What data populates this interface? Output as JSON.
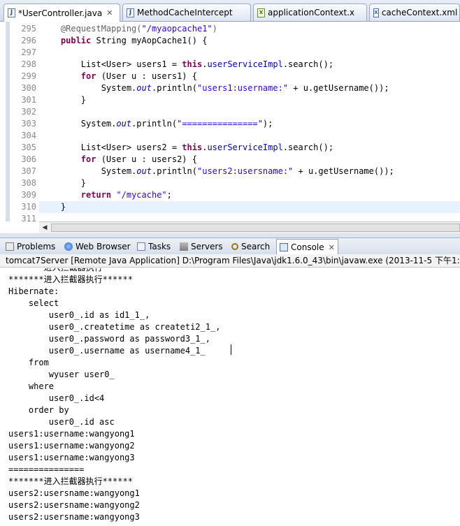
{
  "editor_tabs": [
    {
      "label": "*UserController.java",
      "icon": "java-file-icon",
      "close": "✕",
      "active": true
    },
    {
      "label": "MethodCacheIntercept",
      "icon": "java-file-icon"
    },
    {
      "label": "applicationContext.x",
      "icon": "xml-file-icon"
    },
    {
      "label": "cacheContext.xml",
      "icon": "xml-file-icon"
    }
  ],
  "editor": {
    "line_numbers": [
      "295",
      "296",
      "297",
      "298",
      "299",
      "300",
      "301",
      "302",
      "303",
      "304",
      "305",
      "306",
      "307",
      "308",
      "309",
      "310",
      "311"
    ],
    "lines": [
      [
        {
          "t": "    "
        },
        {
          "t": "@RequestMapping(",
          "c": "ann"
        },
        {
          "t": "\"/myaopcache1\"",
          "c": "str"
        },
        {
          "t": ")",
          "c": "ann"
        }
      ],
      [
        {
          "t": "    "
        },
        {
          "t": "public",
          "c": "kw"
        },
        {
          "t": " String myAopCache1() {"
        }
      ],
      [
        {
          "t": ""
        }
      ],
      [
        {
          "t": "        List<User> users1 = "
        },
        {
          "t": "this",
          "c": "kw"
        },
        {
          "t": "."
        },
        {
          "t": "userServiceImpl",
          "c": "fld"
        },
        {
          "t": ".search();"
        }
      ],
      [
        {
          "t": "        "
        },
        {
          "t": "for",
          "c": "kw"
        },
        {
          "t": " (User u : users1) {"
        }
      ],
      [
        {
          "t": "            System."
        },
        {
          "t": "out",
          "c": "ital"
        },
        {
          "t": ".println("
        },
        {
          "t": "\"users1:username:\"",
          "c": "str"
        },
        {
          "t": " + u.getUsername());"
        }
      ],
      [
        {
          "t": "        }"
        }
      ],
      [
        {
          "t": ""
        }
      ],
      [
        {
          "t": "        System."
        },
        {
          "t": "out",
          "c": "ital"
        },
        {
          "t": ".println("
        },
        {
          "t": "\"===============\"",
          "c": "str"
        },
        {
          "t": ");"
        }
      ],
      [
        {
          "t": ""
        }
      ],
      [
        {
          "t": "        List<User> users2 = "
        },
        {
          "t": "this",
          "c": "kw"
        },
        {
          "t": "."
        },
        {
          "t": "userServiceImpl",
          "c": "fld"
        },
        {
          "t": ".search();"
        }
      ],
      [
        {
          "t": "        "
        },
        {
          "t": "for",
          "c": "kw"
        },
        {
          "t": " (User u : users2) {"
        }
      ],
      [
        {
          "t": "            System."
        },
        {
          "t": "out",
          "c": "ital"
        },
        {
          "t": ".println("
        },
        {
          "t": "\"users2:usersname:\"",
          "c": "str"
        },
        {
          "t": " + u.getUsername());"
        }
      ],
      [
        {
          "t": "        }"
        }
      ],
      [
        {
          "t": "        "
        },
        {
          "t": "return",
          "c": "kw"
        },
        {
          "t": " "
        },
        {
          "t": "\"/mycache\"",
          "c": "str"
        },
        {
          "t": ";"
        }
      ],
      [
        {
          "t": "    }"
        }
      ],
      [
        {
          "t": ""
        }
      ]
    ]
  },
  "view_tabs": [
    {
      "label": "Problems",
      "icon": "problems-icon"
    },
    {
      "label": "Web Browser",
      "icon": "globe-icon"
    },
    {
      "label": "Tasks",
      "icon": "tasks-icon"
    },
    {
      "label": "Servers",
      "icon": "servers-icon"
    },
    {
      "label": "Search",
      "icon": "search-icon"
    },
    {
      "label": "Console",
      "icon": "console-icon",
      "active": true,
      "close": "✕"
    }
  ],
  "console": {
    "header": "tomcat7Server [Remote Java Application] D:\\Program Files\\Java\\jdk1.6.0_43\\bin\\javaw.exe (2013-11-5 下午1:55",
    "lines": [
      "*******进入拦截器执行******",
      "*******进入拦截器执行******",
      "Hibernate:",
      "    select",
      "        user0_.id as id1_1_,",
      "        user0_.createtime as createti2_1_,",
      "        user0_.password as password3_1_,",
      "        user0_.username as username4_1_",
      "    from",
      "        wyuser user0_",
      "    where",
      "        user0_.id<4",
      "    order by",
      "        user0_.id asc",
      "users1:username:wangyong1",
      "users1:username:wangyong2",
      "users1:username:wangyong3",
      "===============",
      "*******进入拦截器执行******",
      "users2:usersname:wangyong1",
      "users2:usersname:wangyong2",
      "users2:usersname:wangyong3"
    ]
  }
}
